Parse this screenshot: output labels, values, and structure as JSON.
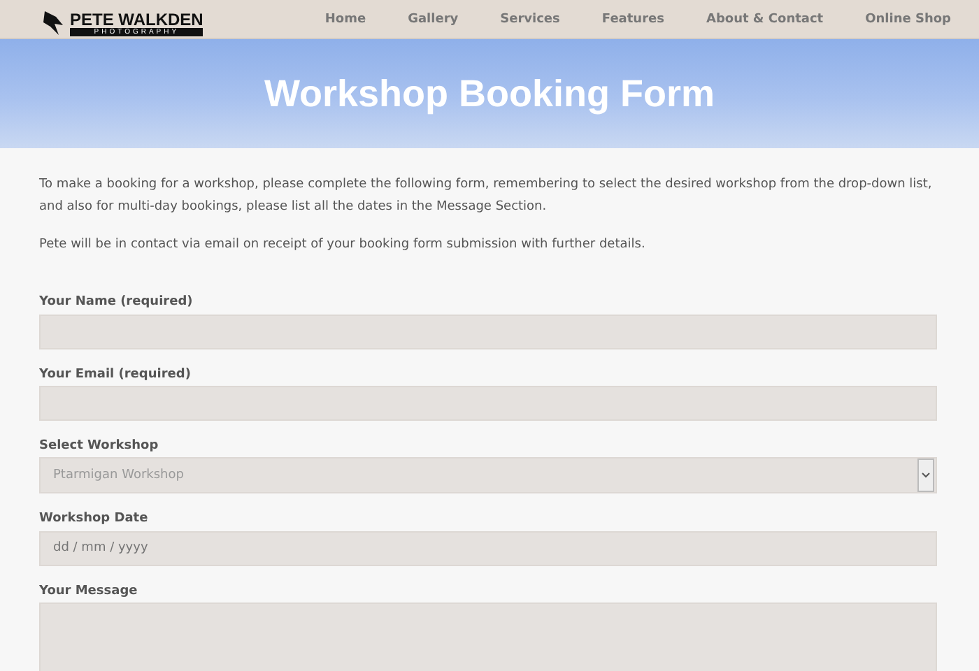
{
  "header": {
    "logo_title": "PETE WALKDEN",
    "logo_subtitle": "PHOTOGRAPHY",
    "nav": [
      {
        "label": "Home"
      },
      {
        "label": "Gallery"
      },
      {
        "label": "Services"
      },
      {
        "label": "Features"
      },
      {
        "label": "About & Contact"
      },
      {
        "label": "Online Shop"
      }
    ]
  },
  "hero": {
    "title": "Workshop Booking Form"
  },
  "intro": [
    "To make a booking for a workshop, please complete the following form, remembering to select the desired workshop from the drop-down list, and also for multi-day bookings, please list all the dates in the Message Section.",
    "Pete will be in contact via email on receipt of your booking form submission with further details."
  ],
  "form": {
    "fields": [
      {
        "kind": "text",
        "label": "Your Name (required)"
      },
      {
        "kind": "text",
        "label": "Your Email (required)"
      },
      {
        "kind": "select",
        "label": "Select Workshop",
        "value": "Ptarmigan Workshop"
      },
      {
        "kind": "date",
        "label": "Workshop Date",
        "placeholder": "dd / mm / yyyy"
      },
      {
        "kind": "textarea",
        "label": "Your Message"
      }
    ]
  }
}
